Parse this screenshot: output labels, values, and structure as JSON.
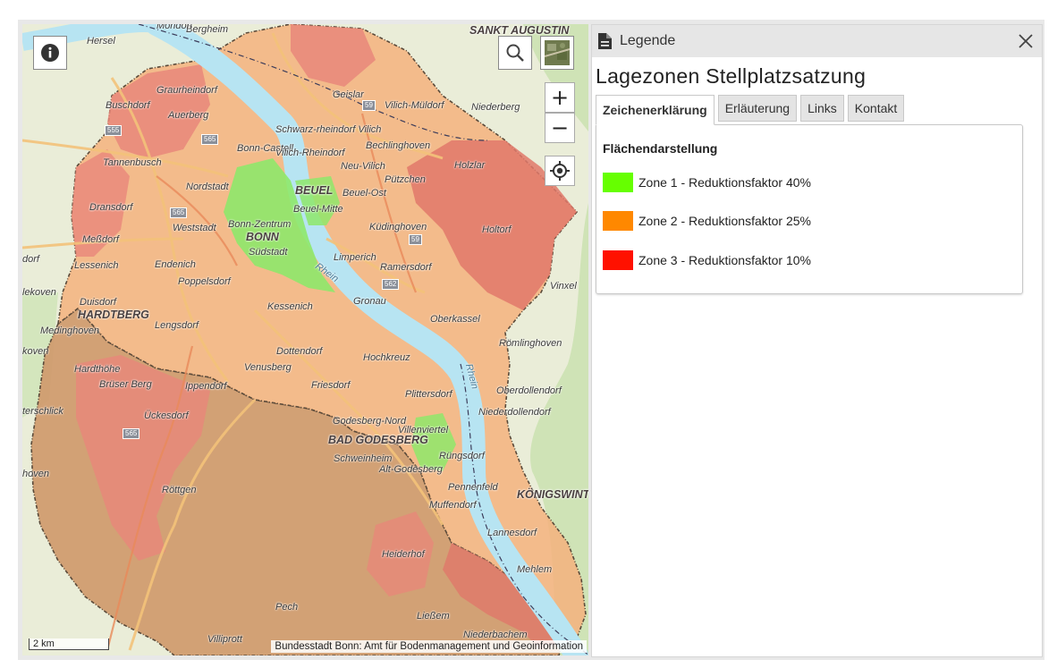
{
  "map": {
    "places": [
      {
        "name": "Hersel"
      },
      {
        "name": "Bergheim"
      },
      {
        "name": "Mondorf"
      },
      {
        "name": "SANKT AUGUSTIN"
      },
      {
        "name": "Graurheindorf"
      },
      {
        "name": "Geislar"
      },
      {
        "name": "Buschdorf"
      },
      {
        "name": "Auerberg"
      },
      {
        "name": "Vilich-Müldorf"
      },
      {
        "name": "Niederberg"
      },
      {
        "name": "Schwarz-rheindorf Vilich"
      },
      {
        "name": "Bonn-Castell"
      },
      {
        "name": "Vilich-Rheindorf"
      },
      {
        "name": "Bechlinghoven"
      },
      {
        "name": "Tannenbusch"
      },
      {
        "name": "Neu-Vilich"
      },
      {
        "name": "Pützchen"
      },
      {
        "name": "Holzlar"
      },
      {
        "name": "Nordstadt"
      },
      {
        "name": "BEUEL"
      },
      {
        "name": "Beuel-Ost"
      },
      {
        "name": "Dransdorf"
      },
      {
        "name": "Beuel-Mitte"
      },
      {
        "name": "Bonn-Zentrum"
      },
      {
        "name": "Weststadt"
      },
      {
        "name": "Küdinghoven"
      },
      {
        "name": "BONN"
      },
      {
        "name": "Holtorf"
      },
      {
        "name": "Meßdorf"
      },
      {
        "name": "Südstadt"
      },
      {
        "name": "Limperich"
      },
      {
        "name": "Ramersdorf"
      },
      {
        "name": "Endenich"
      },
      {
        "name": "Lessenich"
      },
      {
        "name": "Rhein"
      },
      {
        "name": "Poppelsdorf"
      },
      {
        "name": "Vinxel"
      },
      {
        "name": "Duisdorf"
      },
      {
        "name": "Kessenich"
      },
      {
        "name": "Gronau"
      },
      {
        "name": "HARDTBERG"
      },
      {
        "name": "Lengsdorf"
      },
      {
        "name": "Oberkassel"
      },
      {
        "name": "Medinghoven"
      },
      {
        "name": "Römlinghoven"
      },
      {
        "name": "Dottendorf"
      },
      {
        "name": "Hochkreuz"
      },
      {
        "name": "Hardthöhe"
      },
      {
        "name": "Venusberg"
      },
      {
        "name": "Brüser Berg"
      },
      {
        "name": "Ippendorf"
      },
      {
        "name": "Friesdorf"
      },
      {
        "name": "Plittersdorf"
      },
      {
        "name": "Oberdollendorf"
      },
      {
        "name": "Niederdollendorf"
      },
      {
        "name": "Ückesdorf"
      },
      {
        "name": "Godesberg-Nord"
      },
      {
        "name": "Villenviertel"
      },
      {
        "name": "BAD GODESBERG"
      },
      {
        "name": "Schweinheim"
      },
      {
        "name": "Rüngsdorf"
      },
      {
        "name": "Alt-Godesberg"
      },
      {
        "name": "Röttgen"
      },
      {
        "name": "Pennenfeld"
      },
      {
        "name": "KÖNIGSWINT"
      },
      {
        "name": "Muffendorf"
      },
      {
        "name": "Lannesdorf"
      },
      {
        "name": "Heiderhof"
      },
      {
        "name": "Mehlem"
      },
      {
        "name": "Pech"
      },
      {
        "name": "Ließem"
      },
      {
        "name": "Niederbachem"
      },
      {
        "name": "Villiprott"
      },
      {
        "name": "Rhein"
      },
      {
        "name": "dorf"
      },
      {
        "name": "lekoven"
      },
      {
        "name": "koven"
      },
      {
        "name": "terschlick"
      },
      {
        "name": "hoven"
      }
    ],
    "road_badges": [
      "555",
      "565",
      "59",
      "565",
      "59",
      "562",
      "565",
      "59"
    ],
    "scale_label": "2 km",
    "attribution": "Bundesstadt Bonn: Amt für Bodenmanagement und Geoinformation",
    "controls": {
      "info": "info-icon",
      "search": "search-icon",
      "basemap": "aerial-basemap-thumbnail",
      "zoom_in": "+",
      "zoom_out": "−",
      "locate": "locate-icon"
    }
  },
  "legend_panel": {
    "header": "Legende",
    "title": "Lagezonen Stellplatzsatzung",
    "tabs": [
      "Zeichenerklärung",
      "Erläuterung",
      "Links",
      "Kontakt"
    ],
    "active_tab": 0,
    "section_title": "Flächendarstellung",
    "items": [
      {
        "label": "Zone 1 - Reduktionsfaktor 40%",
        "color": "#66ff00"
      },
      {
        "label": "Zone 2 - Reduktionsfaktor 25%",
        "color": "#ff8800"
      },
      {
        "label": "Zone 3 - Reduktionsfaktor 10%",
        "color": "#ff1100"
      }
    ]
  },
  "colors": {
    "zone1_overlay": "#8ee86a",
    "zone2_overlay": "#f5b17e",
    "zone3_overlay": "#e89888",
    "rural_zone": "#cf9a6c",
    "river": "#b7e4f2"
  }
}
